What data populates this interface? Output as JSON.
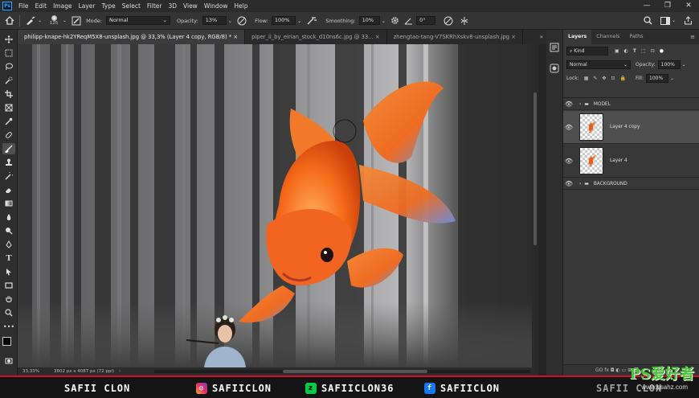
{
  "app": {
    "logo": "Ps"
  },
  "menu": [
    "File",
    "Edit",
    "Image",
    "Layer",
    "Type",
    "Select",
    "Filter",
    "3D",
    "View",
    "Window",
    "Help"
  ],
  "window_controls": [
    "—",
    "❐",
    "✕"
  ],
  "options": {
    "brush_size": "125",
    "mode_label": "Mode:",
    "mode_value": "Normal",
    "opacity_label": "Opacity:",
    "opacity_value": "13%",
    "flow_label": "Flow:",
    "flow_value": "100%",
    "smoothing_label": "Smoothing:",
    "smoothing_value": "10%",
    "angle_value": "0°"
  },
  "tabs": [
    {
      "label": "philipp-knape-hk2YReqM5X8-unsplash.jpg @ 33,3% (Layer 4 copy, RGB/8) *",
      "close": "×"
    },
    {
      "label": "piper_ii_by_eirian_stock_d10ns6c.jpg @ 33...",
      "close": "×"
    },
    {
      "label": "zhengtao-tang-V7SKRhXskv8-unsplash.jpg",
      "close": "×"
    }
  ],
  "tab_overflow": "»",
  "status": {
    "zoom": "33,33%",
    "doc_info": "3602 px x 4087 px (72 ppi)",
    "arrow": "›"
  },
  "layers_panel": {
    "tabs": [
      "Layers",
      "Channels",
      "Paths"
    ],
    "kind_label": "Kind",
    "blend_mode": "Normal",
    "opacity_label": "Opacity:",
    "opacity_value": "100%",
    "lock_label": "Lock:",
    "fill_label": "Fill:",
    "fill_value": "100%",
    "layers": [
      {
        "name": "MODEL",
        "type": "group"
      },
      {
        "name": "Layer 4 copy",
        "type": "pixel",
        "selected": true
      },
      {
        "name": "Layer 4",
        "type": "pixel"
      },
      {
        "name": "BACKGROUND",
        "type": "group"
      }
    ],
    "footer_icons": "GO  fx  ◘  ◐  ▭  ⊞  🗑"
  },
  "banner": {
    "name": "SAFII CLON",
    "instagram": "SAFIICLON",
    "deviantart": "SAFIICLON36",
    "facebook": "SAFIICLON",
    "partial_right": "SAFII CLON",
    "watermark_main": "PS爱好者",
    "watermark_site": "www.psahz.com"
  },
  "colors": {
    "accent": "#d0102a",
    "selection": "#4f4f4f",
    "ps_blue": "#31a8ff"
  }
}
